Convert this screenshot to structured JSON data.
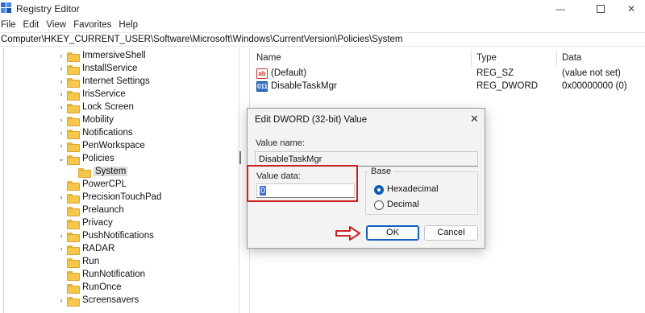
{
  "window": {
    "title": "Registry Editor"
  },
  "menu": [
    "File",
    "Edit",
    "View",
    "Favorites",
    "Help"
  ],
  "address": "Computer\\HKEY_CURRENT_USER\\Software\\Microsoft\\Windows\\CurrentVersion\\Policies\\System",
  "tree": [
    {
      "label": "ImmersiveShell",
      "expander": "›"
    },
    {
      "label": "InstallService",
      "expander": "›"
    },
    {
      "label": "Internet Settings",
      "expander": "›"
    },
    {
      "label": "IrisService",
      "expander": "›"
    },
    {
      "label": "Lock Screen",
      "expander": "›"
    },
    {
      "label": "Mobility",
      "expander": "›"
    },
    {
      "label": "Notifications",
      "expander": "›"
    },
    {
      "label": "PenWorkspace",
      "expander": "›"
    },
    {
      "label": "Policies",
      "expander": "⌄"
    },
    {
      "label": "System",
      "expander": ""
    },
    {
      "label": "PowerCPL",
      "expander": ""
    },
    {
      "label": "PrecisionTouchPad",
      "expander": "›"
    },
    {
      "label": "Prelaunch",
      "expander": ""
    },
    {
      "label": "Privacy",
      "expander": ""
    },
    {
      "label": "PushNotifications",
      "expander": "›"
    },
    {
      "label": "RADAR",
      "expander": "›"
    },
    {
      "label": "Run",
      "expander": ""
    },
    {
      "label": "RunNotification",
      "expander": ""
    },
    {
      "label": "RunOnce",
      "expander": ""
    },
    {
      "label": "Screensavers",
      "expander": "›"
    }
  ],
  "list": {
    "columns": [
      "Name",
      "Type",
      "Data"
    ],
    "rows": [
      {
        "icon": "ab",
        "name": "(Default)",
        "type": "REG_SZ",
        "data": "(value not set)"
      },
      {
        "icon": "011",
        "name": "DisableTaskMgr",
        "type": "REG_DWORD",
        "data": "0x00000000 (0)"
      }
    ]
  },
  "dialog": {
    "title": "Edit DWORD (32-bit) Value",
    "close": "✕",
    "value_name_label": "Value name:",
    "value_name": "DisableTaskMgr",
    "value_data_label": "Value data:",
    "value_data": "0",
    "base_label": "Base",
    "hex_label": "Hexadecimal",
    "dec_label": "Decimal",
    "ok_label": "OK",
    "cancel_label": "Cancel"
  },
  "window_controls": {
    "minimize": "—",
    "close": "✕"
  },
  "colors": {
    "highlight": "#cc2222",
    "accent": "#1060c0",
    "folder": "#f5c84c"
  }
}
